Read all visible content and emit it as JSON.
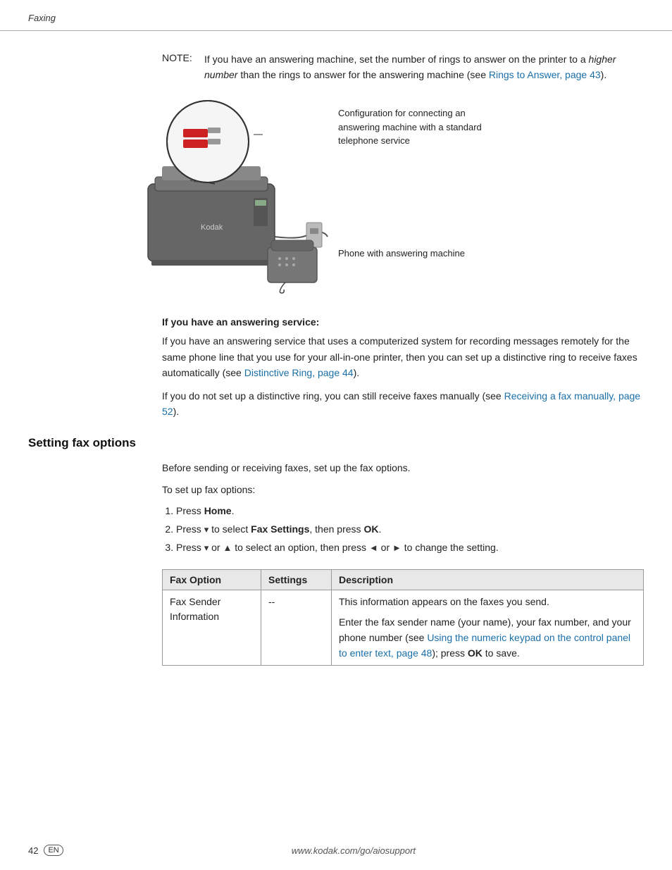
{
  "header": {
    "text": "Faxing"
  },
  "note": {
    "label": "NOTE:",
    "text": "If you have an answering machine, set the number of rings to answer on the printer to a ",
    "italic_text": "higher number",
    "text2": " than the rings to answer for the answering machine (see ",
    "link_text": "Rings to Answer, page 43",
    "text3": ")."
  },
  "diagram": {
    "label_top": "Configuration for connecting an answering machine with a standard telephone service",
    "label_bottom": "Phone with answering machine"
  },
  "answering_service": {
    "title": "If you have an answering service:",
    "para1_text": "If you have an answering service that uses a computerized system for recording messages remotely for the same phone line that you use for your all-in-one printer, then you can set up a distinctive ring to receive faxes automatically (see ",
    "para1_link": "Distinctive Ring, page 44",
    "para1_end": ").",
    "para2_text": "If you do not set up a distinctive ring, you can still receive faxes manually (see ",
    "para2_link": "Receiving a fax manually, page 52",
    "para2_end": ")."
  },
  "section": {
    "heading": "Setting fax options",
    "intro1": "Before sending or receiving faxes, set up the fax options.",
    "intro2": "To set up fax options:",
    "steps": [
      {
        "num": "1",
        "text_before": "Press ",
        "bold": "Home",
        "text_after": "."
      },
      {
        "num": "2",
        "text_before": "Press ",
        "arrow": "▾",
        "text_middle": " to select ",
        "bold": "Fax Settings",
        "text_after": ", then press ",
        "bold2": "OK",
        "text_end": "."
      },
      {
        "num": "3",
        "text_before": "Press ",
        "arrow1": "▾",
        "text_or": " or ",
        "arrow2": "▲",
        "text_middle": " to select an option, then press ",
        "arrow3": "◄",
        "text_or2": " or ",
        "arrow4": "►",
        "text_end": " to change the setting."
      }
    ]
  },
  "table": {
    "headers": [
      "Fax Option",
      "Settings",
      "Description"
    ],
    "rows": [
      {
        "option": "Fax Sender Information",
        "settings": "--",
        "description_1": "This information appears on the faxes you send.",
        "description_2": "Enter the fax sender name (your name), your fax number, and your phone number (see ",
        "description_link": "Using the numeric keypad on the control panel to enter text, page 48",
        "description_end": "); press ",
        "description_bold": "OK",
        "description_final": " to save."
      }
    ]
  },
  "footer": {
    "page_num": "42",
    "en_badge": "EN",
    "url": "www.kodak.com/go/aiosupport"
  }
}
